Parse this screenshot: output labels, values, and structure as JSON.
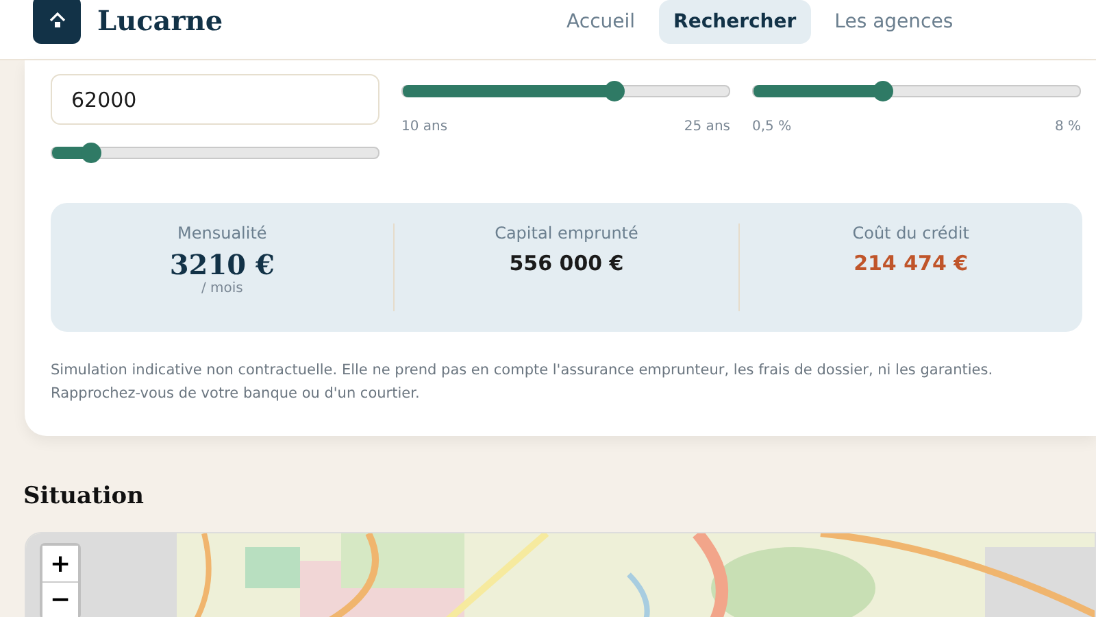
{
  "header": {
    "logo": "Lucarne",
    "nav": [
      {
        "label": "Accueil",
        "selected": false
      },
      {
        "label": "Rechercher",
        "selected": true
      },
      {
        "label": "Les agences",
        "selected": false
      }
    ]
  },
  "simulator": {
    "amount": {
      "value": "62000",
      "level": 0.12
    },
    "sliders": [
      {
        "level": 0.65,
        "min_label": "10 ans",
        "max_label": "25 ans"
      },
      {
        "level": 0.4,
        "min_label": "0,5 %",
        "max_label": "8 %"
      }
    ],
    "results": [
      {
        "kind": "main",
        "label": "Mensualité",
        "value": "3210 €",
        "unit": "/ mois"
      },
      {
        "kind": "plain",
        "label": "Capital emprunté",
        "value": "556 000 €"
      },
      {
        "kind": "cost",
        "label": "Coût du crédit",
        "value": "214 474 €"
      }
    ],
    "disclaimer": "Simulation indicative non contractuelle. Elle ne prend pas en compte l'assurance emprunteur, les frais de dossier, ni les garanties. Rapprochez-vous de votre banque ou d'un courtier."
  },
  "location": {
    "title": "Situation",
    "map": {
      "kind": "picture",
      "zoom_in": "+",
      "zoom_out": "−"
    }
  }
}
